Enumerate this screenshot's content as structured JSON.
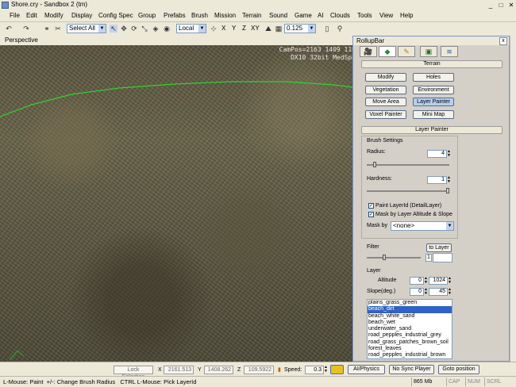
{
  "window": {
    "title": "Shore.cry - Sandbox 2 (tm)",
    "minimize": "_",
    "restore": "□",
    "close": "✕"
  },
  "menu": [
    "File",
    "Edit",
    "Modify",
    "Display",
    "Config Spec",
    "Group",
    "Prefabs",
    "Brush",
    "Mission",
    "Terrain",
    "Sound",
    "Game",
    "AI",
    "Clouds",
    "Tools",
    "View",
    "Help"
  ],
  "toolbar": {
    "select_combo": "Select All",
    "coord_combo": "Local",
    "axes": [
      "X",
      "Y",
      "Z",
      "XY"
    ],
    "snap_value": "0.125"
  },
  "viewport": {
    "title": "Perspective",
    "campos_line1": "CamPos=2163 1409 110",
    "campos_line2": "DX10 32bit MedSpe"
  },
  "rollup": {
    "title": "RollupBar",
    "close": "x",
    "terrain_section": "Terrain",
    "terrain_buttons": [
      "Modify",
      "Holes",
      "Vegetation",
      "Environment",
      "Move Area",
      "Layer Painter",
      "Voxel Painter",
      "Mini Map"
    ],
    "layer_painter_section": "Layer Painter",
    "brush_settings": "Brush Settings",
    "radius_label": "Radius:",
    "radius_value": "4",
    "hardness_label": "Hardness:",
    "hardness_value": "1",
    "paint_layerid": "Paint LayerId (DetailLayer)",
    "mask_altitude": "Mask by Layer Altitude & Slope",
    "mask_by_label": "Mask by",
    "mask_by_value": "<none>",
    "filter_label": "Filter",
    "to_layer": "to Layer",
    "filter_value": "1",
    "layer_label": "Layer",
    "altitude_label": "Altitude",
    "altitude_min": "0",
    "altitude_max": "1024",
    "slope_label": "Slope(deg.)",
    "slope_min": "0",
    "slope_max": "45",
    "layers": [
      "plains_grass_green",
      "beach_dirt",
      "beach_white_sand",
      "beach_wet",
      "underwater_sand",
      "road_pepples_industrial_grey",
      "road_grass_patches_brown_soil",
      "forest_leaves",
      "road_pepples_industrial_brown"
    ],
    "selected_layer": 1
  },
  "bottom": {
    "lock_selection": "Lock Selection",
    "x_label": "X",
    "x_value": "2161.513",
    "y_label": "Y",
    "y_value": "1408.262",
    "z_label": "Z",
    "z_value": "109.5922",
    "speed_label": "Speed:",
    "speed_value": "0.3",
    "ai_physics": "AI/Physics",
    "no_sync": "No Sync Player",
    "goto_position": "Goto position"
  },
  "status": {
    "hint": "L-Mouse: Paint  +/-: Change Brush Radius   CTRL L-Mouse: Pick LayerId",
    "memory": "865 Mb",
    "cap": "CAP",
    "num": "NUM",
    "scrl": "SCRL"
  },
  "colors": {
    "accent": "#3162c5",
    "active_button": "#b6cff0",
    "terrain_line": "#2fd42f"
  }
}
